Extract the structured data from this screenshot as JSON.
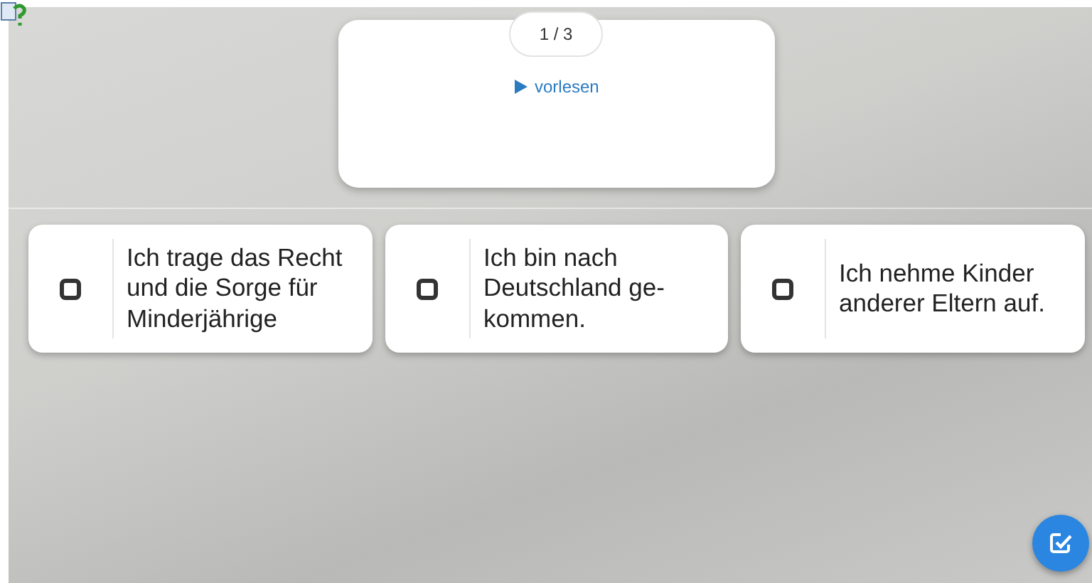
{
  "question": {
    "counter": "1 / 3",
    "read_aloud": "vorlesen"
  },
  "options": [
    {
      "lines": [
        "Ich trage das Recht",
        "und die Sorge für",
        "Minderjährige"
      ],
      "checked": false
    },
    {
      "lines": [
        "Ich bin nach",
        "Deutschland ge-",
        "kommen."
      ],
      "checked": false
    },
    {
      "lines": [
        "Ich nehme Kinder",
        "anderer Eltern auf."
      ],
      "checked": false
    }
  ]
}
